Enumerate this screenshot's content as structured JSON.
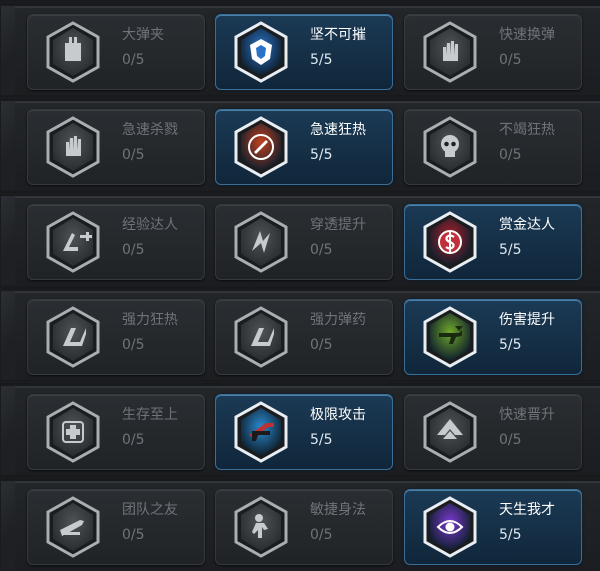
{
  "rows": [
    [
      {
        "name": "大弹夹",
        "level": "0/5",
        "active": false,
        "icon": "magazine-icon",
        "color": "#7a7f84"
      },
      {
        "name": "坚不可摧",
        "level": "5/5",
        "active": true,
        "icon": "shield-armor-icon",
        "color": "#2a74c8"
      },
      {
        "name": "快速换弹",
        "level": "0/5",
        "active": false,
        "icon": "hand-reload-icon",
        "color": "#7a7f84"
      }
    ],
    [
      {
        "name": "急速杀戮",
        "level": "0/5",
        "active": false,
        "icon": "hand-kill-icon",
        "color": "#7a7f84"
      },
      {
        "name": "急速狂热",
        "level": "5/5",
        "active": true,
        "icon": "ammo-frenzy-icon",
        "color": "#c2401e"
      },
      {
        "name": "不竭狂热",
        "level": "0/5",
        "active": false,
        "icon": "skull-icon",
        "color": "#7a7f84"
      }
    ],
    [
      {
        "name": "经验达人",
        "level": "0/5",
        "active": false,
        "icon": "exp-plus-icon",
        "color": "#7a7f84"
      },
      {
        "name": "穿透提升",
        "level": "0/5",
        "active": false,
        "icon": "penetration-icon",
        "color": "#7a7f84"
      },
      {
        "name": "赏金达人",
        "level": "5/5",
        "active": true,
        "icon": "bounty-coin-icon",
        "color": "#b0202a"
      }
    ],
    [
      {
        "name": "强力狂热",
        "level": "0/5",
        "active": false,
        "icon": "power-frenzy-icon",
        "color": "#7a7f84"
      },
      {
        "name": "强力弹药",
        "level": "0/5",
        "active": false,
        "icon": "power-ammo-icon",
        "color": "#7a7f84"
      },
      {
        "name": "伤害提升",
        "level": "5/5",
        "active": true,
        "icon": "damage-gun-icon",
        "color": "#6fa82a"
      }
    ],
    [
      {
        "name": "生存至上",
        "level": "0/5",
        "active": false,
        "icon": "medkit-icon",
        "color": "#7a7f84"
      },
      {
        "name": "极限攻击",
        "level": "5/5",
        "active": true,
        "icon": "extreme-attack-icon",
        "color": "#2a8ad0"
      },
      {
        "name": "快速晋升",
        "level": "0/5",
        "active": false,
        "icon": "rank-up-icon",
        "color": "#7a7f84"
      }
    ],
    [
      {
        "name": "团队之友",
        "level": "0/5",
        "active": false,
        "icon": "team-rifle-icon",
        "color": "#7a7f84"
      },
      {
        "name": "敏捷身法",
        "level": "0/5",
        "active": false,
        "icon": "agile-soldier-icon",
        "color": "#7a7f84"
      },
      {
        "name": "天生我才",
        "level": "5/5",
        "active": true,
        "icon": "eye-talent-icon",
        "color": "#7a3ad0"
      }
    ]
  ]
}
